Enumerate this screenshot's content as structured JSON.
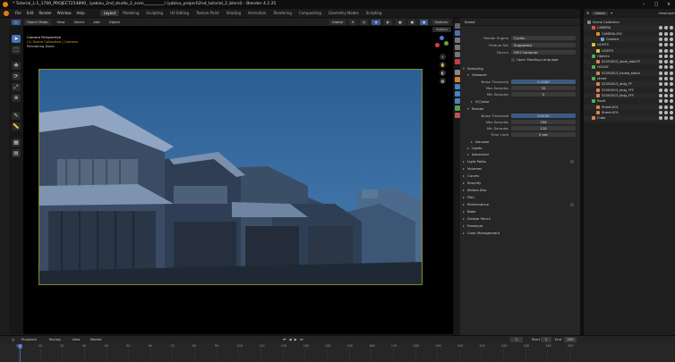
{
  "window": {
    "title": "* Tutorial_L-1_1700_PROJECT254890_ (yakisu_2nd_studio_2_scen__________) (yakisu_project\\2nd_tutorial_2_blend) - Blender 4.2.25"
  },
  "menu": {
    "items": [
      "File",
      "Edit",
      "Render",
      "Window",
      "Help"
    ],
    "workspaces": [
      "Layout",
      "Modeling",
      "Sculpting",
      "UV Editing",
      "Texture Paint",
      "Shading",
      "Animation",
      "Rendering",
      "Compositing",
      "Geometry Nodes",
      "Scripting"
    ],
    "active_workspace": "Layout"
  },
  "viewport_header": {
    "mode": "Object Mode",
    "buttons": [
      "View",
      "Select",
      "Add",
      "Object"
    ],
    "pivot": "Global",
    "options": "Options"
  },
  "viewport": {
    "overlay_line1": "Camera Perspective",
    "overlay_line2": "(1) Scene Collection | Camera",
    "overlay_line3": "Rendering Done",
    "tools": [
      "cursor",
      "select-box",
      "move",
      "rotate",
      "scale",
      "transform",
      "annotate",
      "measure",
      "add-cube"
    ]
  },
  "render_properties": {
    "header": "Scene",
    "render_engine_label": "Render Engine",
    "render_engine": "Cycles",
    "feature_set_label": "Feature Set",
    "feature_set": "Supported",
    "device_label": "Device",
    "device": "GPU Compute",
    "open_shading_label": "Open Shading Language",
    "sections": {
      "sampling": "Sampling",
      "viewport": "Viewport",
      "noise_threshold_label": "Noise Threshold",
      "vp_noise_threshold": "0.1000",
      "max_samples_label": "Max Samples",
      "vp_max_samples": "32",
      "min_samples_label": "Min Samples",
      "vp_min_samples": "0",
      "denoise": "Denoise",
      "render": "Render",
      "r_noise_threshold": "0.0100",
      "r_max_samples": "256",
      "r_min_samples": "128",
      "time_limit_label": "Time Limit",
      "r_time_limit": "0 sec",
      "lights": "Lights",
      "advanced": "Advanced",
      "light_paths": "Light Paths",
      "volumes": "Volumes",
      "curves": "Curves",
      "simplify": "Simplify",
      "motion_blur": "Motion Blur",
      "film": "Film",
      "performance": "Performance",
      "bake": "Bake",
      "grease_pencil": "Grease Pencil",
      "freestyle": "Freestyle",
      "color_management": "Color Management"
    }
  },
  "outliner": {
    "search": "Global",
    "view_layer": "ViewLayer",
    "items": [
      {
        "label": "Scene Collection",
        "depth": 0,
        "color": "#8a8a8a"
      },
      {
        "label": "CAMERA",
        "depth": 1,
        "color": "#e05050"
      },
      {
        "label": "CAMERA.001",
        "depth": 2,
        "color": "#e09030"
      },
      {
        "label": "Camera",
        "depth": 3,
        "color": "#70a0d0"
      },
      {
        "label": "LIGHTS",
        "depth": 1,
        "color": "#e0c040"
      },
      {
        "label": "LIGHTS",
        "depth": 2,
        "color": "#e0c040"
      },
      {
        "label": "Objects",
        "depth": 1,
        "color": "#50b050"
      },
      {
        "label": "02091813_store_wall.FF",
        "depth": 2,
        "color": "#e08050"
      },
      {
        "label": "HOUSE",
        "depth": 1,
        "color": "#50b050"
      },
      {
        "label": "02091813_house_stand",
        "depth": 2,
        "color": "#e08050"
      },
      {
        "label": "street",
        "depth": 1,
        "color": "#50b050"
      },
      {
        "label": "02091813_bldg_FF",
        "depth": 2,
        "color": "#e08050"
      },
      {
        "label": "02091813_bldg_FFF",
        "depth": 2,
        "color": "#e08050"
      },
      {
        "label": "02091813_bldg_FFF",
        "depth": 2,
        "color": "#e08050"
      },
      {
        "label": "Road",
        "depth": 1,
        "color": "#50b050"
      },
      {
        "label": "Street.001",
        "depth": 2,
        "color": "#e08050"
      },
      {
        "label": "Street.002",
        "depth": 2,
        "color": "#e08050"
      },
      {
        "label": "Cube",
        "depth": 1,
        "color": "#e08050"
      }
    ]
  },
  "timeline": {
    "menus": [
      "Playback",
      "Keying",
      "View",
      "Marker"
    ],
    "current_frame": "1",
    "start_label": "Start",
    "start": "1",
    "end_label": "End",
    "end": "250",
    "ticks": [
      "0",
      "10",
      "20",
      "30",
      "40",
      "50",
      "60",
      "70",
      "80",
      "90",
      "100",
      "110",
      "120",
      "130",
      "140",
      "150",
      "160",
      "170",
      "180",
      "190",
      "200",
      "210",
      "220",
      "230",
      "240",
      "250"
    ]
  },
  "colors": {
    "accent": "#4772b3",
    "camera_frame": "#8a8a20",
    "sky": "#2c5d8f"
  }
}
